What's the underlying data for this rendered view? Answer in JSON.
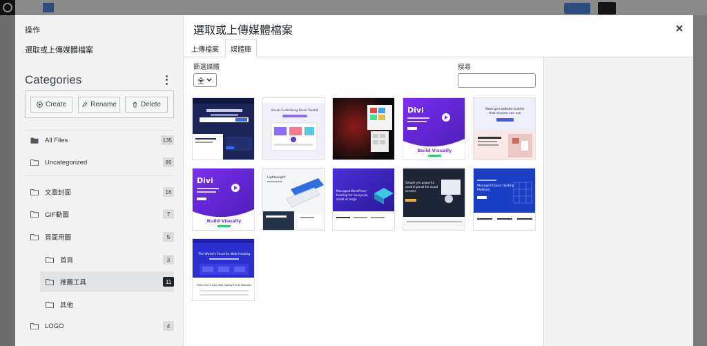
{
  "modal": {
    "title": "選取或上傳媒體檔案",
    "tabs": [
      {
        "label": "上傳檔案",
        "active": false
      },
      {
        "label": "媒體庫",
        "active": true
      }
    ]
  },
  "sidebar": {
    "actions_label": "操作",
    "menu_item": "選取或上傳媒體檔案",
    "categories_title": "Categories",
    "buttons": {
      "create": "Create",
      "rename": "Rename",
      "delete": "Delete"
    },
    "items": [
      {
        "label": "All Files",
        "count": "135",
        "icon": "folder-filled-icon",
        "level": 0,
        "active": false
      },
      {
        "label": "Uncategorized",
        "count": "89",
        "icon": "folder-icon",
        "level": 0,
        "active": false
      },
      {
        "label": "文章封面",
        "count": "16",
        "icon": "folder-icon",
        "level": 0,
        "active": false
      },
      {
        "label": "GIF動圖",
        "count": "7",
        "icon": "folder-icon",
        "level": 0,
        "active": false
      },
      {
        "label": "頁面用圖",
        "count": "5",
        "icon": "folder-icon",
        "level": 0,
        "active": false
      },
      {
        "label": "首頁",
        "count": "3",
        "icon": "folder-icon",
        "level": 1,
        "active": false
      },
      {
        "label": "推薦工具",
        "count": "11",
        "icon": "folder-icon",
        "level": 1,
        "active": true
      },
      {
        "label": "其他",
        "count": "",
        "icon": "folder-icon",
        "level": 1,
        "active": false
      },
      {
        "label": "LOGO",
        "count": "4",
        "icon": "folder-icon",
        "level": 0,
        "active": false
      }
    ]
  },
  "filter": {
    "label": "篩選媒體",
    "selected": "全"
  },
  "search": {
    "label": "搜尋",
    "value": ""
  },
  "thumbnails": [
    {
      "name": "thumb-dark-navy-hero",
      "texts": []
    },
    {
      "name": "thumb-visual-builder-toolkit",
      "texts": [
        "Visual Gutenberg Block Toolkit"
      ]
    },
    {
      "name": "thumb-black-red-design",
      "texts": []
    },
    {
      "name": "thumb-divi-purple",
      "texts": [
        "Divi",
        "Build Visually"
      ]
    },
    {
      "name": "thumb-website-builder-pink",
      "texts": [
        "Next-gen website builder",
        "that anyone can use"
      ]
    },
    {
      "name": "thumb-divi-purple-2",
      "texts": [
        "Divi",
        "Build Visually"
      ]
    },
    {
      "name": "thumb-lightweight-theme",
      "texts": [
        "Lightweight"
      ]
    },
    {
      "name": "thumb-managed-wordpress",
      "texts": [
        "Managed WordPress",
        "Hosting for everyone,",
        "small or large"
      ]
    },
    {
      "name": "thumb-cloud-panel",
      "texts": [
        "Simple yet powerful",
        "control panel for cloud",
        "servers"
      ]
    },
    {
      "name": "thumb-managed-cloud-hosting",
      "texts": [
        "Managed Cloud Hosting",
        "Platform"
      ]
    },
    {
      "name": "thumb-web-hosting",
      "texts": [
        "The World's Favorite Web Hosting",
        "Pretty Fast & Easy Web Hosting For All Websites"
      ]
    }
  ]
}
